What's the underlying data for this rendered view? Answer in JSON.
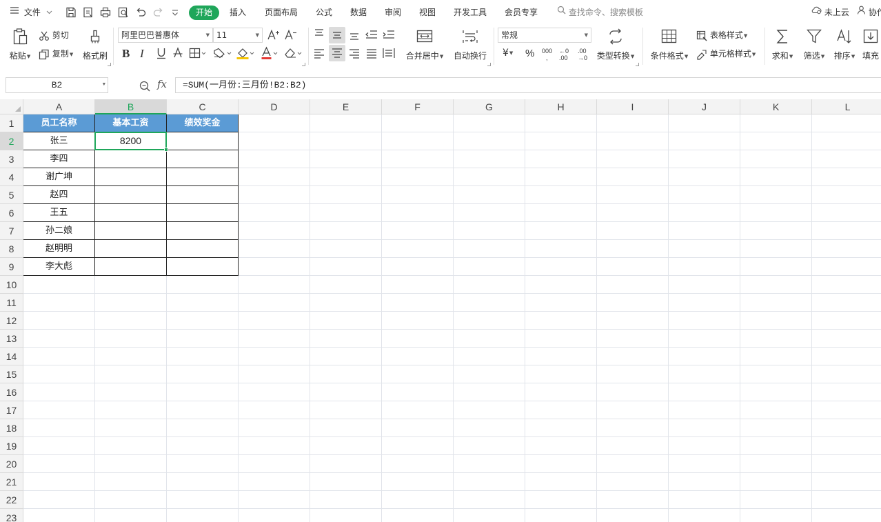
{
  "menubar": {
    "file": "文件",
    "tabs": [
      "开始",
      "插入",
      "页面布局",
      "公式",
      "数据",
      "审阅",
      "视图",
      "开发工具",
      "会员专享"
    ],
    "search_placeholder": "查找命令、搜索模板",
    "sync_status": "未上云",
    "collab": "协作"
  },
  "ribbon": {
    "paste": "粘贴",
    "cut": "剪切",
    "copy": "复制",
    "format_painter": "格式刷",
    "font_name": "阿里巴巴普惠体",
    "font_size": "11",
    "merge_center": "合并居中",
    "wrap_text": "自动换行",
    "number_format": "常规",
    "type_convert": "类型转换",
    "conditional_format": "条件格式",
    "table_style": "表格样式",
    "cell_style": "单元格样式",
    "sum": "求和",
    "filter": "筛选",
    "sort": "排序",
    "fill": "填充",
    "currency_symbol": "¥",
    "percent_symbol": "%",
    "thousands": "000",
    "dec_inc": "←0 .00",
    "dec_dec": ".00 →0"
  },
  "formula_bar": {
    "name_box": "B2",
    "fx": "fx",
    "formula": "=SUM(一月份:三月份!B2:B2)"
  },
  "sheet": {
    "columns": [
      "A",
      "B",
      "C",
      "D",
      "E",
      "F",
      "G",
      "H",
      "I",
      "J",
      "K",
      "L"
    ],
    "rows": [
      "1",
      "2",
      "3",
      "4",
      "5",
      "6",
      "7",
      "8",
      "9",
      "10",
      "11",
      "12",
      "13",
      "14",
      "15",
      "16",
      "17",
      "18",
      "19",
      "20",
      "21",
      "22",
      "23"
    ],
    "active_cell": "B2",
    "active_col": "B",
    "active_row": "2",
    "header_fill": "#5b9bd5",
    "accent": "#1fa65a",
    "table": {
      "headers": [
        "员工名称",
        "基本工资",
        "绩效奖金"
      ],
      "rows": [
        [
          "张三",
          "8200",
          ""
        ],
        [
          "李四",
          "",
          ""
        ],
        [
          "谢广坤",
          "",
          ""
        ],
        [
          "赵四",
          "",
          ""
        ],
        [
          "王五",
          "",
          ""
        ],
        [
          "孙二娘",
          "",
          ""
        ],
        [
          "赵明明",
          "",
          ""
        ],
        [
          "李大彪",
          "",
          ""
        ]
      ]
    }
  }
}
